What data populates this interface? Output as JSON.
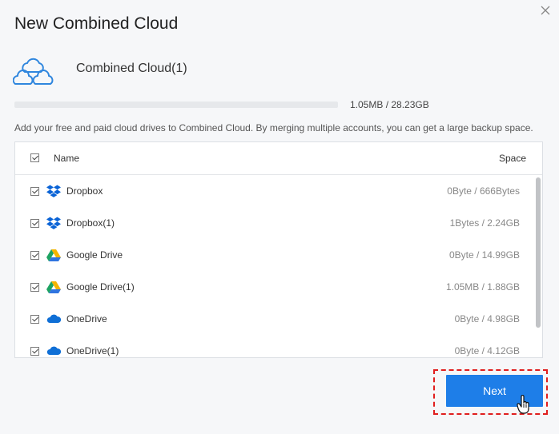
{
  "dialog": {
    "title": "New Combined Cloud",
    "cloud_name": "Combined Cloud(1)",
    "usage_text": "1.05MB / 28.23GB",
    "usage_fraction": 0.0,
    "description": "Add your free and paid cloud drives to Combined Cloud. By merging multiple accounts, you can get a large backup space.",
    "next_label": "Next"
  },
  "table": {
    "header": {
      "name": "Name",
      "space": "Space"
    },
    "rows": [
      {
        "name": "Dropbox",
        "space": "0Byte / 666Bytes",
        "icon": "dropbox-icon"
      },
      {
        "name": "Dropbox(1)",
        "space": "1Bytes / 2.24GB",
        "icon": "dropbox-icon"
      },
      {
        "name": "Google Drive",
        "space": "0Byte / 14.99GB",
        "icon": "google-drive-icon"
      },
      {
        "name": "Google Drive(1)",
        "space": "1.05MB / 1.88GB",
        "icon": "google-drive-icon"
      },
      {
        "name": "OneDrive",
        "space": "0Byte / 4.98GB",
        "icon": "onedrive-icon"
      },
      {
        "name": "OneDrive(1)",
        "space": "0Byte / 4.12GB",
        "icon": "onedrive-icon"
      }
    ]
  },
  "colors": {
    "accent": "#1e7ee8",
    "highlight": "#e01e1e"
  }
}
